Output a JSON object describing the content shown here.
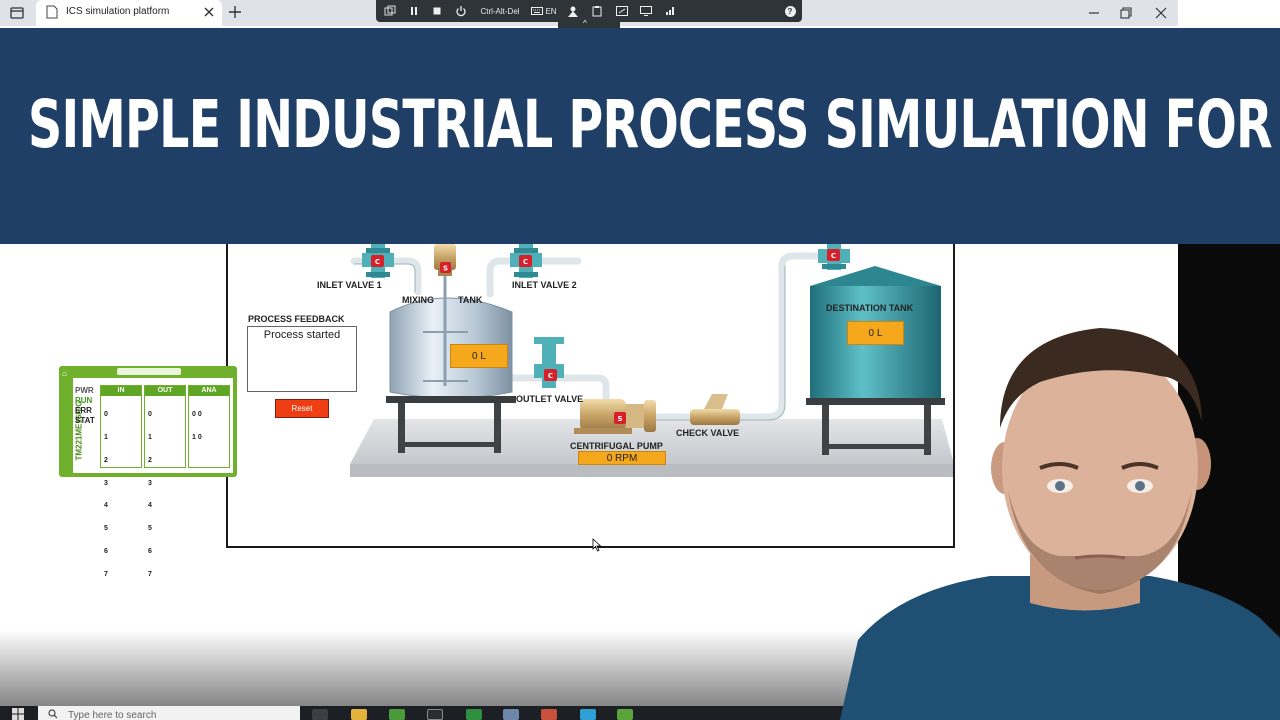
{
  "browser": {
    "tab_title": "ICS simulation platform"
  },
  "remote_toolbar": {
    "ctrl_alt_del": "Ctrl-Alt-Del",
    "keyboard_lang": "EN",
    "help": "?"
  },
  "banner": {
    "title": "SIMPLE INDUSTRIAL PROCESS SIMULATION FOR TRAIN"
  },
  "simulation": {
    "labels": {
      "inlet_valve_1": "INLET VALVE 1",
      "inlet_valve_2": "INLET VALVE 2",
      "mixing": "MIXING",
      "tank": "TANK",
      "outlet_valve": "OUTLET VALVE",
      "centrifugal_pump": "CENTRIFUGAL PUMP",
      "check_valve": "CHECK VALVE",
      "destination_tank": "DESTINATION TANK",
      "process_feedback": "PROCESS FEEDBACK"
    },
    "mixing_tank_level": "0 L",
    "destination_tank_level": "0 L",
    "pump_speed": "0 RPM",
    "feedback_message": "Process started",
    "reset_label": "Reset",
    "valve_badge": "C",
    "motor_badge": "S"
  },
  "plc": {
    "model": "TM221ME16R/G",
    "status": [
      "PWR",
      "RUN",
      "ERR",
      "STAT"
    ],
    "columns": {
      "in": {
        "header": "IN",
        "values": [
          "0",
          "1",
          "2",
          "3",
          "4",
          "5",
          "6",
          "7"
        ]
      },
      "out": {
        "header": "OUT",
        "values": [
          "0",
          "1",
          "2",
          "3",
          "4",
          "5",
          "6",
          "7"
        ]
      },
      "ana": {
        "header": "ANA",
        "values": [
          "0 0",
          "1 0"
        ]
      }
    }
  },
  "taskbar": {
    "search_placeholder": "Type here to search"
  },
  "colors": {
    "banner_bg": "#1f3f66",
    "plc_green": "#6fb02d",
    "plc_run_green": "#3c9a1c",
    "level_orange": "#f6a81c",
    "reset_red": "#ee3e14",
    "valve_red": "#d8202a",
    "pipe_teal": "#4fb0b8"
  }
}
